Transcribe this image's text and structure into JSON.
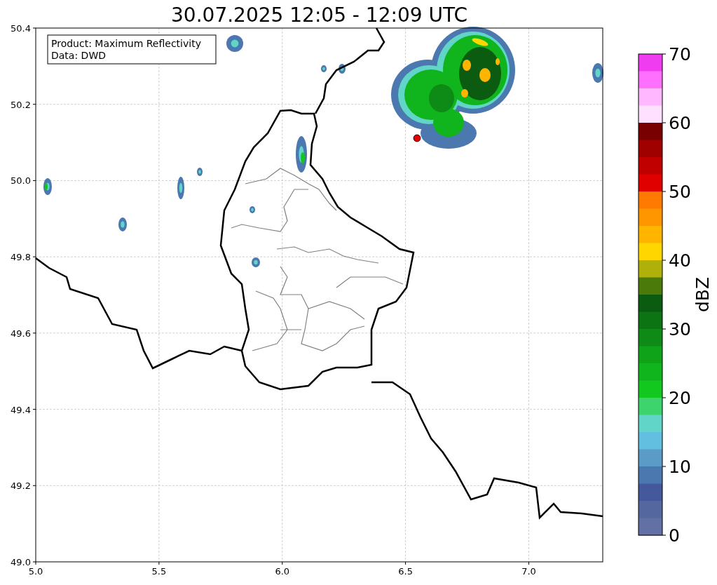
{
  "title": "30.07.2025 12:05 - 12:09 UTC",
  "legend": [
    "Product: Maximum Reflectivity",
    "Data: DWD"
  ],
  "map": {
    "xticks": [
      "5.0",
      "5.5",
      "6.0",
      "6.5",
      "7.0"
    ],
    "yticks": [
      "50.4",
      "50.2",
      "50.0",
      "49.8",
      "49.6",
      "49.4",
      "49.2",
      "49.0"
    ]
  },
  "colorbar": {
    "label": "dBZ",
    "ticks": [
      "70",
      "60",
      "50",
      "40",
      "30",
      "20",
      "10",
      "0"
    ],
    "segments": [
      {
        "color": "#f03cf0"
      },
      {
        "color": "#ff70ff"
      },
      {
        "color": "#ffb8ff"
      },
      {
        "color": "#ffe0ff"
      },
      {
        "color": "#780000"
      },
      {
        "color": "#9f0000"
      },
      {
        "color": "#c00000"
      },
      {
        "color": "#e00000"
      },
      {
        "color": "#ff7a00"
      },
      {
        "color": "#ff9600"
      },
      {
        "color": "#ffb400"
      },
      {
        "color": "#ffd600"
      },
      {
        "color": "#b0b00a"
      },
      {
        "color": "#4b7a0a"
      },
      {
        "color": "#0b5b10"
      },
      {
        "color": "#0d7414"
      },
      {
        "color": "#0e8b16"
      },
      {
        "color": "#0ea319"
      },
      {
        "color": "#10b41c"
      },
      {
        "color": "#12c81e"
      },
      {
        "color": "#3dd46e"
      },
      {
        "color": "#60d5c8"
      },
      {
        "color": "#63bfe0"
      },
      {
        "color": "#5a9bc8"
      },
      {
        "color": "#4c78b0"
      },
      {
        "color": "#44589c"
      },
      {
        "color": "#55679f"
      },
      {
        "color": "#6370a6"
      }
    ]
  }
}
